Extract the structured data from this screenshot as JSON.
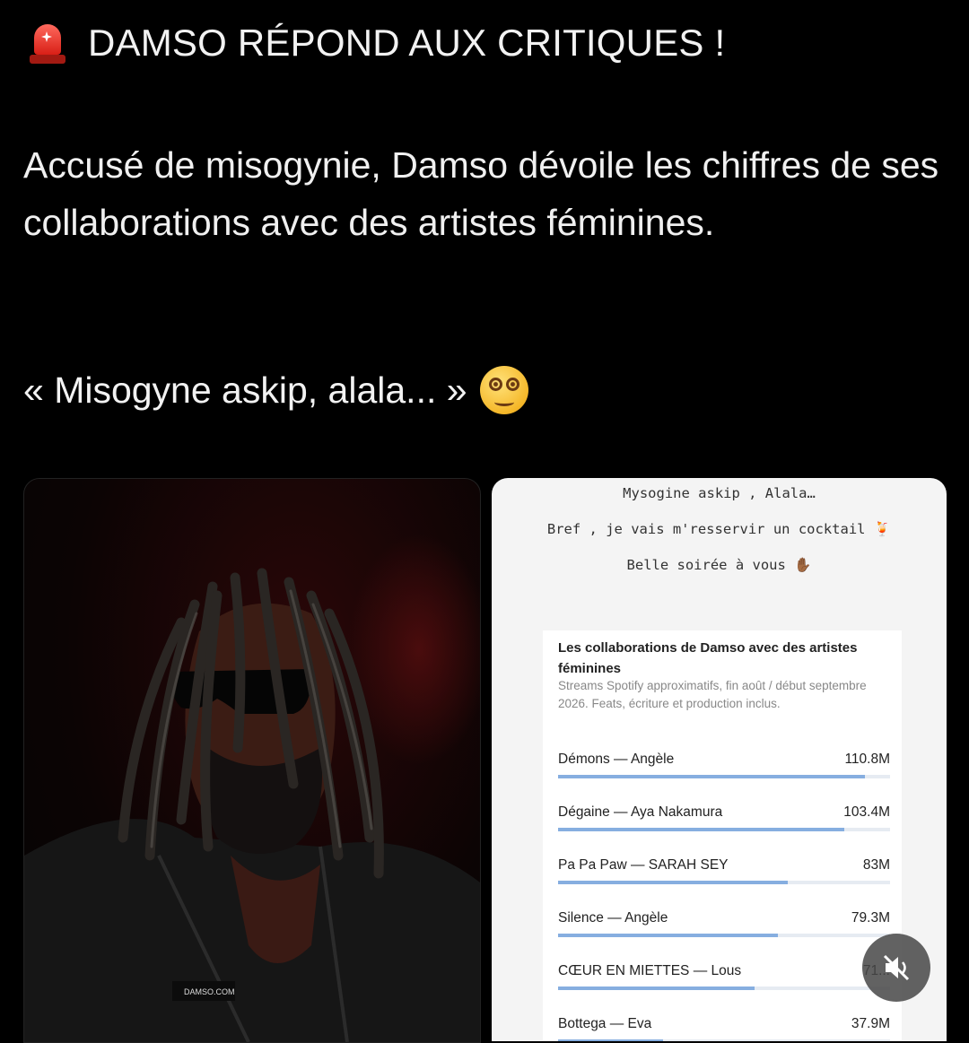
{
  "headline": {
    "text": "DAMSO RÉPOND AUX CRITIQUES !",
    "icon": "police-siren-icon"
  },
  "body": "Accusé de misogynie, Damso dévoile les chiffres de ses collaborations avec des artistes féminines.",
  "quote": {
    "text": "« Misogyne askip, alala... »",
    "icon": "dizzy-face-emoji"
  },
  "photo": {
    "jacket_label": "DAMSO.COM"
  },
  "story": {
    "caption_lines": [
      "Mysogine askip , Alala…",
      "Bref , je vais m'resservir un cocktail 🍹",
      "Belle soirée à vous ✋🏾"
    ],
    "chart_title": "Les collaborations de Damso avec des artistes féminines",
    "chart_subtitle": "Streams Spotify approximatifs, fin août / début septembre 2026. Feats, écriture et production inclus."
  },
  "chart_data": {
    "type": "bar",
    "title": "Les collaborations de Damso avec des artistes féminines",
    "subtitle": "Streams Spotify approximatifs, fin août / début septembre 2026. Feats, écriture et production inclus.",
    "categories": [
      "Démons — Angèle",
      "Dégaine — Aya Nakamura",
      "Pa Pa Paw — SARAH SEY",
      "Silence — Angèle",
      "CŒUR EN MIETTES — Lous",
      "Bottega — Eva"
    ],
    "values": [
      110.8,
      103.4,
      83,
      79.3,
      71,
      37.9
    ],
    "value_labels": [
      "110.8M",
      "103.4M",
      "83M",
      "79.3M",
      "71...",
      "37.9M"
    ],
    "unit": "M",
    "xlim": [
      0,
      120
    ],
    "colors": {
      "bar": "#86aee0",
      "track": "#e6ebf2"
    }
  },
  "controls": {
    "mute_icon": "muted-speaker-icon"
  }
}
